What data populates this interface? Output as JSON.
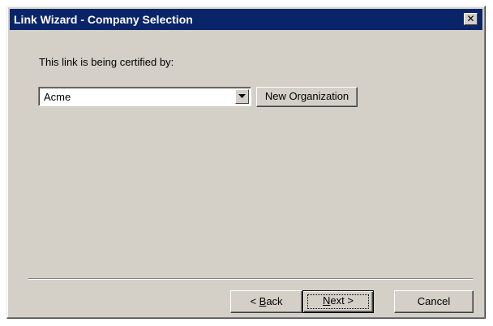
{
  "window": {
    "title": "Link Wizard - Company Selection",
    "close_glyph": "✕"
  },
  "content": {
    "certified_label": "This link is being certified by:",
    "company_combo": {
      "selected": "Acme"
    },
    "new_org_button": "New Organization"
  },
  "footer": {
    "back": {
      "prefix": "< ",
      "mnemonic": "B",
      "rest": "ack"
    },
    "next": {
      "mnemonic": "N",
      "rest": "ext >"
    },
    "cancel": "Cancel"
  },
  "colors": {
    "titlebar": "#0a246a",
    "face": "#d4d0c8"
  },
  "icons": {
    "close": "close-icon",
    "dropdown": "chevron-down-icon"
  }
}
